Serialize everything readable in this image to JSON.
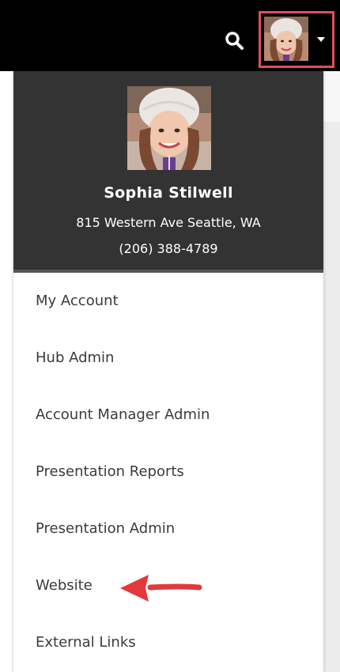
{
  "header": {
    "search_icon": "search-icon",
    "avatar_icon": "avatar",
    "caret_icon": "caret-down-icon",
    "highlight_color": "#e14f52"
  },
  "profile": {
    "name": "Sophia Stilwell",
    "address": "815 Western Ave Seattle, WA",
    "phone": "(206) 388-4789"
  },
  "menu": {
    "items": [
      {
        "label": "My Account"
      },
      {
        "label": "Hub Admin"
      },
      {
        "label": "Account Manager Admin"
      },
      {
        "label": "Presentation Reports"
      },
      {
        "label": "Presentation Admin"
      },
      {
        "label": "Website"
      },
      {
        "label": "External Links"
      }
    ]
  },
  "annotation": {
    "arrow_icon": "red-arrow-icon",
    "arrow_color": "#e2393c"
  }
}
